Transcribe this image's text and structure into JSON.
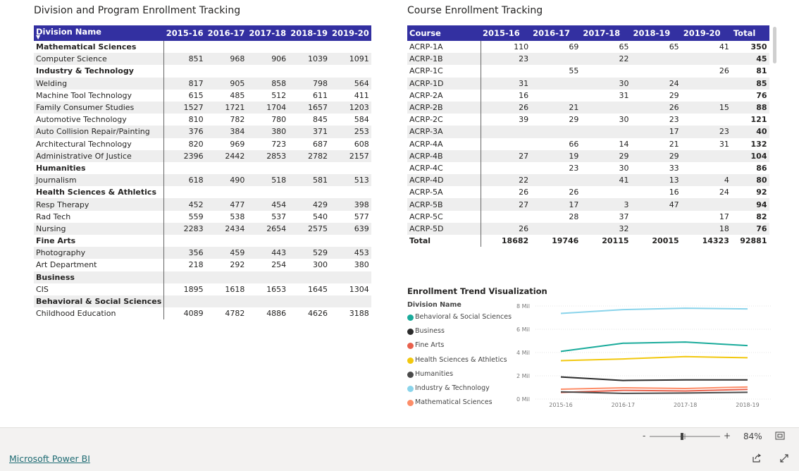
{
  "left_title": "Division and Program Enrollment Tracking",
  "right_title": "Course Enrollment Tracking",
  "division_table": {
    "headers": [
      "Division Name",
      "2015-16",
      "2016-17",
      "2017-18",
      "2018-19",
      "2019-20"
    ],
    "sort_indicator": "▼",
    "rows": [
      {
        "type": "group",
        "name": "Mathematical Sciences"
      },
      {
        "type": "child",
        "name": "Computer Science",
        "values": [
          "851",
          "968",
          "906",
          "1039",
          "1091"
        ]
      },
      {
        "type": "group",
        "name": "Industry & Technology"
      },
      {
        "type": "child",
        "name": "Welding",
        "values": [
          "817",
          "905",
          "858",
          "798",
          "564"
        ]
      },
      {
        "type": "child",
        "name": "Machine Tool Technology",
        "values": [
          "615",
          "485",
          "512",
          "611",
          "411"
        ]
      },
      {
        "type": "child",
        "name": "Family Consumer Studies",
        "values": [
          "1527",
          "1721",
          "1704",
          "1657",
          "1203"
        ]
      },
      {
        "type": "child",
        "name": "Automotive Technology",
        "values": [
          "810",
          "782",
          "780",
          "845",
          "584"
        ]
      },
      {
        "type": "child",
        "name": "Auto Collision Repair/Painting",
        "values": [
          "376",
          "384",
          "380",
          "371",
          "253"
        ]
      },
      {
        "type": "child",
        "name": "Architectural Technology",
        "values": [
          "820",
          "969",
          "723",
          "687",
          "608"
        ]
      },
      {
        "type": "child",
        "name": "Administrative Of Justice",
        "values": [
          "2396",
          "2442",
          "2853",
          "2782",
          "2157"
        ]
      },
      {
        "type": "group",
        "name": "Humanities"
      },
      {
        "type": "child",
        "name": "Journalism",
        "values": [
          "618",
          "490",
          "518",
          "581",
          "513"
        ]
      },
      {
        "type": "group",
        "name": "Health Sciences & Athletics"
      },
      {
        "type": "child",
        "name": "Resp Therapy",
        "values": [
          "452",
          "477",
          "454",
          "429",
          "398"
        ]
      },
      {
        "type": "child",
        "name": "Rad Tech",
        "values": [
          "559",
          "538",
          "537",
          "540",
          "577"
        ]
      },
      {
        "type": "child",
        "name": "Nursing",
        "values": [
          "2283",
          "2434",
          "2654",
          "2575",
          "639"
        ]
      },
      {
        "type": "group",
        "name": "Fine Arts"
      },
      {
        "type": "child",
        "name": "Photography",
        "values": [
          "356",
          "459",
          "443",
          "529",
          "453"
        ]
      },
      {
        "type": "child",
        "name": "Art Department",
        "values": [
          "218",
          "292",
          "254",
          "300",
          "380"
        ]
      },
      {
        "type": "group",
        "name": "Business"
      },
      {
        "type": "child",
        "name": "CIS",
        "values": [
          "1895",
          "1618",
          "1653",
          "1645",
          "1304"
        ]
      },
      {
        "type": "group",
        "name": "Behavioral & Social Sciences"
      },
      {
        "type": "child",
        "name": "Childhood Education",
        "values": [
          "4089",
          "4782",
          "4886",
          "4626",
          "3188"
        ]
      }
    ]
  },
  "course_table": {
    "headers": [
      "Course",
      "2015-16",
      "2016-17",
      "2017-18",
      "2018-19",
      "2019-20",
      "Total"
    ],
    "rows": [
      [
        "ACRP-1A",
        "110",
        "69",
        "65",
        "65",
        "41",
        "350"
      ],
      [
        "ACRP-1B",
        "23",
        "",
        "22",
        "",
        "",
        "45"
      ],
      [
        "ACRP-1C",
        "",
        "55",
        "",
        "",
        "26",
        "81"
      ],
      [
        "ACRP-1D",
        "31",
        "",
        "30",
        "24",
        "",
        "85"
      ],
      [
        "ACRP-2A",
        "16",
        "",
        "31",
        "29",
        "",
        "76"
      ],
      [
        "ACRP-2B",
        "26",
        "21",
        "",
        "26",
        "15",
        "88"
      ],
      [
        "ACRP-2C",
        "39",
        "29",
        "30",
        "23",
        "",
        "121"
      ],
      [
        "ACRP-3A",
        "",
        "",
        "",
        "17",
        "23",
        "40"
      ],
      [
        "ACRP-4A",
        "",
        "66",
        "14",
        "21",
        "31",
        "132"
      ],
      [
        "ACRP-4B",
        "27",
        "19",
        "29",
        "29",
        "",
        "104"
      ],
      [
        "ACRP-4C",
        "",
        "23",
        "30",
        "33",
        "",
        "86"
      ],
      [
        "ACRP-4D",
        "22",
        "",
        "41",
        "13",
        "4",
        "80"
      ],
      [
        "ACRP-5A",
        "26",
        "26",
        "",
        "16",
        "24",
        "92"
      ],
      [
        "ACRP-5B",
        "27",
        "17",
        "3",
        "47",
        "",
        "94"
      ],
      [
        "ACRP-5C",
        "",
        "28",
        "37",
        "",
        "17",
        "82"
      ],
      [
        "ACRP-5D",
        "26",
        "",
        "32",
        "",
        "18",
        "76"
      ]
    ],
    "total": [
      "Total",
      "18682",
      "19746",
      "20115",
      "20015",
      "14323",
      "92881"
    ]
  },
  "trend": {
    "title": "Enrollment Trend Visualization",
    "legend_title": "Division Name"
  },
  "chart_data": {
    "type": "line",
    "title": "Enrollment Trend Visualization",
    "x": [
      "2015-16",
      "2016-17",
      "2017-18",
      "2018-19"
    ],
    "y_ticks": [
      "0 Mil",
      "2 Mil",
      "4 Mil",
      "6 Mil",
      "8 Mil"
    ],
    "ylim": [
      0,
      8
    ],
    "grid": true,
    "legend_placement": "left",
    "series": [
      {
        "name": "Behavioral & Social Sciences",
        "color": "#1aab9b",
        "values": [
          4.1,
          4.8,
          4.9,
          4.6
        ]
      },
      {
        "name": "Business",
        "color": "#2b2b2b",
        "values": [
          1.9,
          1.6,
          1.65,
          1.65
        ]
      },
      {
        "name": "Fine Arts",
        "color": "#e8604c",
        "values": [
          0.57,
          0.75,
          0.7,
          0.83
        ]
      },
      {
        "name": "Health Sciences & Athletics",
        "color": "#f2c80f",
        "values": [
          3.3,
          3.45,
          3.65,
          3.55
        ]
      },
      {
        "name": "Humanities",
        "color": "#4a4a4a",
        "values": [
          0.62,
          0.49,
          0.52,
          0.58
        ]
      },
      {
        "name": "Industry & Technology",
        "color": "#8ad4eb",
        "values": [
          7.36,
          7.69,
          7.81,
          7.75
        ]
      },
      {
        "name": "Mathematical Sciences",
        "color": "#fd8d68",
        "values": [
          0.85,
          0.97,
          0.91,
          1.04
        ]
      }
    ]
  },
  "footer": {
    "brand_link": "Microsoft Power BI",
    "zoom_minus": "-",
    "zoom_plus": "+",
    "zoom_level": "84%",
    "zoom_fraction": 0.46
  }
}
